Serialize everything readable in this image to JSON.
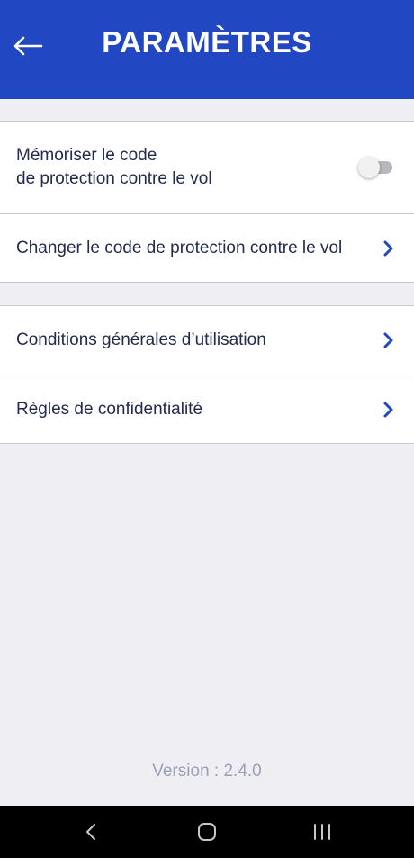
{
  "header": {
    "title": "PARAMÈTRES",
    "back_icon": "arrow-left-icon",
    "background": "#2147c2"
  },
  "settings": {
    "remember_code": {
      "label_line1": "Mémoriser le code",
      "label_line2": "de protection contre le vol",
      "enabled": false
    },
    "change_code": {
      "label": "Changer le code de protection contre le vol"
    },
    "terms": {
      "label": "Conditions générales d’utilisation"
    },
    "privacy": {
      "label": "Règles de confidentialité"
    }
  },
  "footer": {
    "version": "Version : 2.4.0"
  },
  "colors": {
    "accent": "#2147c2",
    "text": "#232a4d",
    "background": "#efeef3"
  },
  "system_nav": {
    "back_icon": "chevron-left-icon",
    "home_icon": "home-icon",
    "recents_icon": "recent-apps-icon"
  }
}
